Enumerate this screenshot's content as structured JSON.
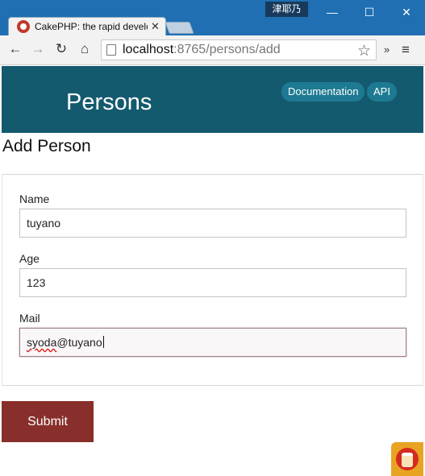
{
  "window": {
    "user_badge": "津耶乃",
    "min_glyph": "—",
    "max_glyph": "☐",
    "close_glyph": "✕"
  },
  "tab": {
    "title": "CakePHP: the rapid develo",
    "close_glyph": "✕"
  },
  "toolbar": {
    "back_glyph": "←",
    "forward_glyph": "→",
    "reload_glyph": "↻",
    "home_glyph": "⌂",
    "url_host": "localhost",
    "url_path": ":8765/persons/add",
    "star_glyph": "☆",
    "extensions_glyph": "»",
    "menu_glyph": "≡"
  },
  "header": {
    "title": "Persons",
    "nav": [
      "Documentation",
      "API"
    ]
  },
  "page": {
    "heading": "Add Person"
  },
  "form": {
    "name_label": "Name",
    "name_value": "tuyano",
    "age_label": "Age",
    "age_value": "123",
    "mail_label": "Mail",
    "mail_value_user": "syoda",
    "mail_value_domain": "@tuyano",
    "submit_label": "Submit"
  },
  "colors": {
    "header_bg": "#145a6e",
    "nav_pill_bg": "#1d7a92",
    "submit_bg": "#882f2b",
    "titlebar_bg": "#1f6fb2"
  }
}
